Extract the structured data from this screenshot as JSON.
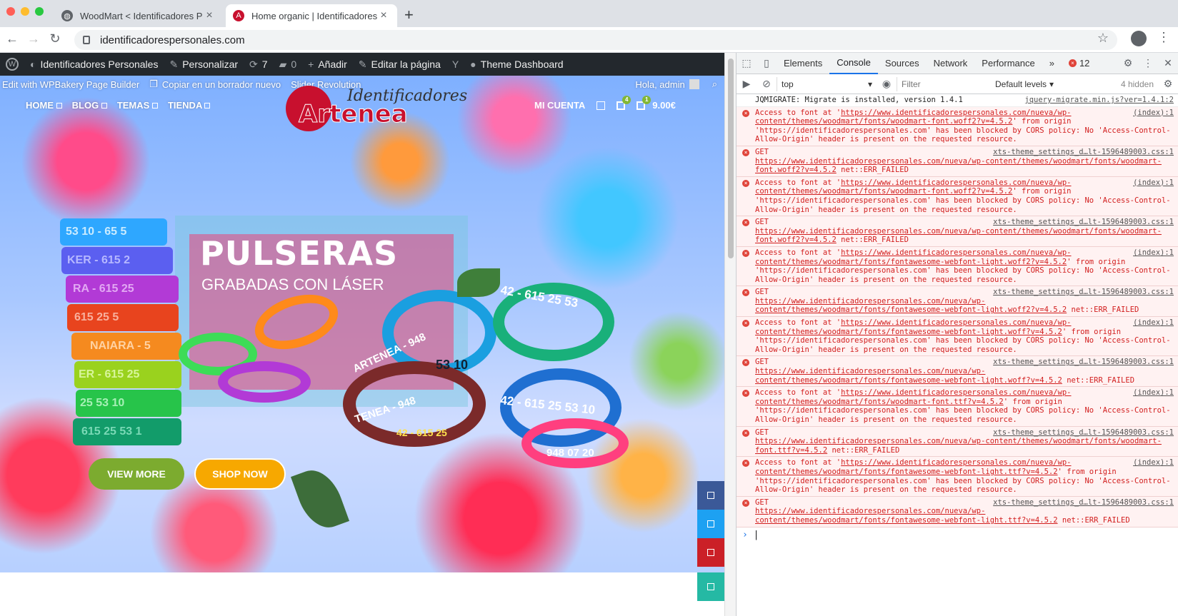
{
  "browser": {
    "tabs": [
      {
        "title": "WoodMart < Identificadores Pe",
        "active": false
      },
      {
        "title": "Home organic | Identificadores",
        "active": true
      }
    ],
    "url": "identificadorespersonales.com"
  },
  "adminbar": {
    "site_name": "Identificadores Personales",
    "customize": "Personalizar",
    "updates": "7",
    "comments": "0",
    "add_new": "Añadir",
    "edit_page": "Editar la página",
    "theme_dashboard": "Theme Dashboard"
  },
  "editbar": {
    "wpbakery": "Edit with WPBakery Page Builder",
    "copy_draft": "Copiar en un borrador nuevo",
    "slider": "Slider Revolution",
    "greeting": "Hola, admin"
  },
  "site_nav": {
    "items": [
      "HOME",
      "BLOG",
      "TEMAS",
      "TIENDA"
    ],
    "account": "MI CUENTA",
    "wishlist_count": "4",
    "cart_count": "1",
    "cart_total": "9.00€"
  },
  "logo": {
    "brand": "Artenea",
    "tagline": "Identificadores"
  },
  "hero": {
    "title": "PULSERAS",
    "subtitle": "GRABADAS CON LÁSER",
    "btn_view": "VIEW MORE",
    "btn_shop": "SHOP NOW",
    "band_texts": [
      "53 10 - 65 5",
      "KER - 615 2",
      "RA - 615 25",
      "615 25 5",
      "NAIARA - 5",
      "ER - 615 25",
      "25 53 10",
      "615 25 53 1"
    ],
    "ring_texts": [
      "ARTENEA - 948",
      "42 - 615 25 53",
      "53 10",
      "42 - 615 25 53 10",
      "948 07 20",
      "TENEA - 948",
      "42 - 615 25"
    ]
  },
  "colors": {
    "view_more": "#7cab2f",
    "shop_now": "#f7a800",
    "social": [
      "#3b5998",
      "#1da1f2",
      "#cb2027",
      "#25b9a4"
    ]
  },
  "devtools": {
    "tabs": [
      "Elements",
      "Console",
      "Sources",
      "Network",
      "Performance"
    ],
    "more": "»",
    "error_count": "12",
    "context": "top",
    "filter_placeholder": "Filter",
    "levels": "Default levels",
    "hidden": "4 hidden",
    "messages": [
      {
        "type": "info",
        "text": "JQMIGRATE: Migrate is installed, version 1.4.1",
        "src": "jquery-migrate.min.js?ver=1.4.1:2"
      },
      {
        "type": "error",
        "pre": "Access to font at '",
        "url": "https://www.identificadorespersonales.com/nueva/wp-content/themes/woodmart/fonts/woodmart-font.woff2?v=4.5.2",
        "post": "' from origin 'https://identificadorespersonales.com' has been blocked by CORS policy: No 'Access-Control-Allow-Origin' header is present on the requested resource.",
        "src": "(index):1"
      },
      {
        "type": "error",
        "pre": "GET ",
        "url": "https://www.identificadorespersonales.com/nueva/wp-content/themes/woodmart/fonts/woodmart-font.woff2?v=4.5.2",
        "post": " net::ERR_FAILED",
        "src": "xts-theme_settings_d…lt-1596489003.css:1"
      },
      {
        "type": "error",
        "pre": "Access to font at '",
        "url": "https://www.identificadorespersonales.com/nueva/wp-content/themes/woodmart/fonts/woodmart-font.woff2?v=4.5.2",
        "post": "' from origin 'https://identificadorespersonales.com' has been blocked by CORS policy: No 'Access-Control-Allow-Origin' header is present on the requested resource.",
        "src": "(index):1"
      },
      {
        "type": "error",
        "pre": "GET ",
        "url": "https://www.identificadorespersonales.com/nueva/wp-content/themes/woodmart/fonts/woodmart-font.woff2?v=4.5.2",
        "post": " net::ERR_FAILED",
        "src": "xts-theme_settings_d…lt-1596489003.css:1"
      },
      {
        "type": "error",
        "pre": "Access to font at '",
        "url": "https://www.identificadorespersonales.com/nueva/wp-content/themes/woodmart/fonts/fontawesome-webfont-light.woff2?v=4.5.2",
        "post": "' from origin 'https://identificadorespersonales.com' has been blocked by CORS policy: No 'Access-Control-Allow-Origin' header is present on the requested resource.",
        "src": "(index):1"
      },
      {
        "type": "error",
        "pre": "GET ",
        "url": "https://www.identificadorespersonales.com/nueva/wp-content/themes/woodmart/fonts/fontawesome-webfont-light.woff2?v=4.5.2",
        "post": " net::ERR_FAILED",
        "src": "xts-theme_settings_d…lt-1596489003.css:1"
      },
      {
        "type": "error",
        "pre": "Access to font at '",
        "url": "https://www.identificadorespersonales.com/nueva/wp-content/themes/woodmart/fonts/fontawesome-webfont-light.woff?v=4.5.2",
        "post": "' from origin 'https://identificadorespersonales.com' has been blocked by CORS policy: No 'Access-Control-Allow-Origin' header is present on the requested resource.",
        "src": "(index):1"
      },
      {
        "type": "error",
        "pre": "GET ",
        "url": "https://www.identificadorespersonales.com/nueva/wp-content/themes/woodmart/fonts/fontawesome-webfont-light.woff?v=4.5.2",
        "post": " net::ERR_FAILED",
        "src": "xts-theme_settings_d…lt-1596489003.css:1"
      },
      {
        "type": "error",
        "pre": "Access to font at '",
        "url": "https://www.identificadorespersonales.com/nueva/wp-content/themes/woodmart/fonts/woodmart-font.ttf?v=4.5.2",
        "post": "' from origin 'https://identificadorespersonales.com' has been blocked by CORS policy: No 'Access-Control-Allow-Origin' header is present on the requested resource.",
        "src": "(index):1"
      },
      {
        "type": "error",
        "pre": "GET ",
        "url": "https://www.identificadorespersonales.com/nueva/wp-content/themes/woodmart/fonts/woodmart-font.ttf?v=4.5.2",
        "post": " net::ERR_FAILED",
        "src": "xts-theme_settings_d…lt-1596489003.css:1"
      },
      {
        "type": "error",
        "pre": "Access to font at '",
        "url": "https://www.identificadorespersonales.com/nueva/wp-content/themes/woodmart/fonts/fontawesome-webfont-light.ttf?v=4.5.2",
        "post": "' from origin 'https://identificadorespersonales.com' has been blocked by CORS policy: No 'Access-Control-Allow-Origin' header is present on the requested resource.",
        "src": "(index):1"
      },
      {
        "type": "error",
        "pre": "GET ",
        "url": "https://www.identificadorespersonales.com/nueva/wp-content/themes/woodmart/fonts/fontawesome-webfont-light.ttf?v=4.5.2",
        "post": " net::ERR_FAILED",
        "src": "xts-theme_settings_d…lt-1596489003.css:1"
      }
    ]
  }
}
